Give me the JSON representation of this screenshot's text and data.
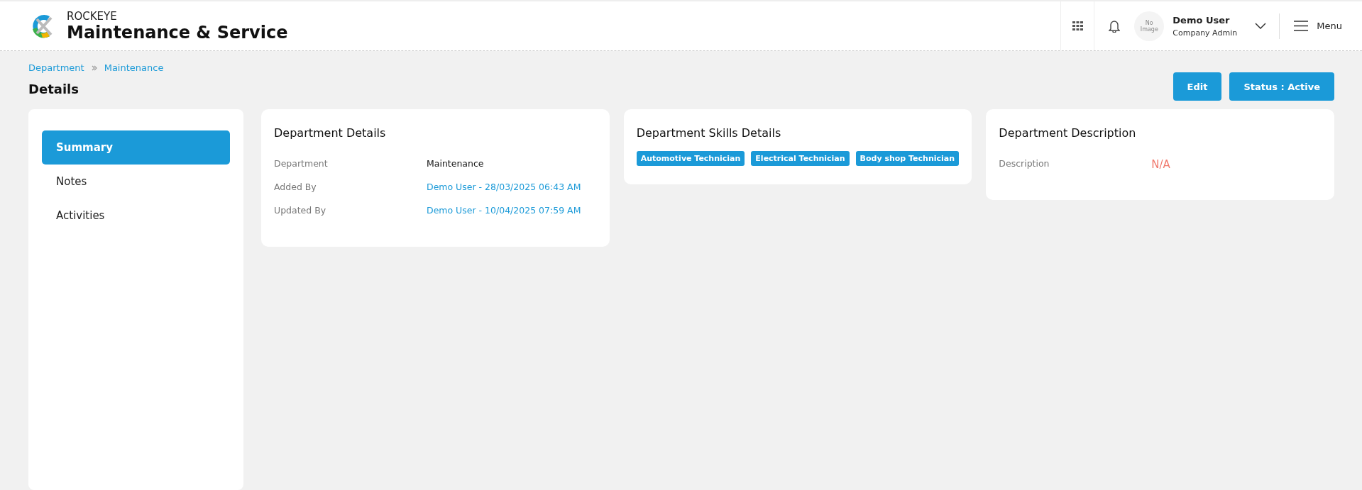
{
  "header": {
    "brand": "ROCKEYE",
    "app_title": "Maintenance & Service",
    "avatar_text": "No Image",
    "user_name": "Demo User",
    "user_role": "Company Admin",
    "menu_label": "Menu"
  },
  "breadcrumb": [
    "Department",
    "Maintenance"
  ],
  "page_title": "Details",
  "actions": [
    "Edit",
    "Status : Active"
  ],
  "sidebar": {
    "items": [
      {
        "label": "Summary",
        "selected": true
      },
      {
        "label": "Notes",
        "selected": false
      },
      {
        "label": "Activities",
        "selected": false
      }
    ]
  },
  "cards": [
    {
      "kind": "fields",
      "title": "Department Details",
      "rows": [
        {
          "label": "Department",
          "value": "Maintenance",
          "kind": "plain"
        },
        {
          "label": "Added By",
          "value": "Demo User - 28/03/2025 06:43 AM",
          "kind": "link"
        },
        {
          "label": "Updated By",
          "value": "Demo User - 10/04/2025 07:59 AM",
          "kind": "link"
        }
      ]
    },
    {
      "kind": "tags",
      "title": "Department Skills Details",
      "tags": [
        "Automotive Technician",
        "Electrical Technician",
        "Body shop Technician"
      ]
    },
    {
      "kind": "fields",
      "title": "Department Description",
      "rows": [
        {
          "label": "Description",
          "value": "N/A",
          "kind": "empty"
        }
      ]
    }
  ]
}
